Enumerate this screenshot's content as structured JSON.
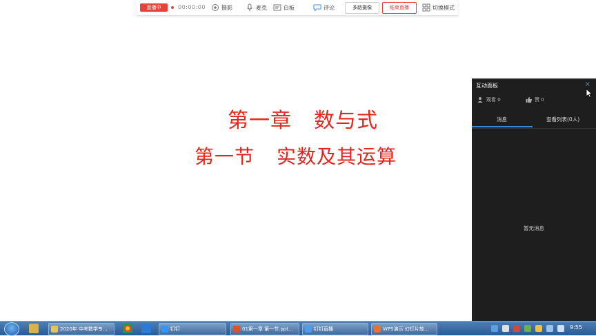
{
  "toolbar": {
    "live_badge": "直播中",
    "timer": "00:00:00",
    "camera_label": "摄影",
    "mic_label": "麦克",
    "whiteboard_label": "白板",
    "comment_label": "评论",
    "multi_camera_label": "多路摄像",
    "end_live_label": "结束直播",
    "switch_mode_label": "切换模式"
  },
  "slide": {
    "chapter": "第一章",
    "chapter_topic": "数与式",
    "section": "第一节",
    "section_topic": "实数及其运算"
  },
  "panel": {
    "title": "互动面板",
    "close_glyph": "×",
    "viewers_label": "观看 0",
    "likes_label": "赞 0",
    "tab_messages": "消息",
    "tab_members": "查看列表(0人)",
    "empty_message": "暂无消息"
  },
  "taskbar": {
    "tasks": [
      "2020年 中考数学专...",
      "钉钉",
      "01第一章 第一节.ppt...",
      "钉钉直播",
      "WPS演示 幻灯片放..."
    ],
    "clock": "9:55"
  },
  "colors": {
    "accent_red": "#e4261c",
    "panel_bg": "#1e1e1e",
    "tab_blue": "#3d86d6",
    "taskbar": "#2c5a93"
  }
}
